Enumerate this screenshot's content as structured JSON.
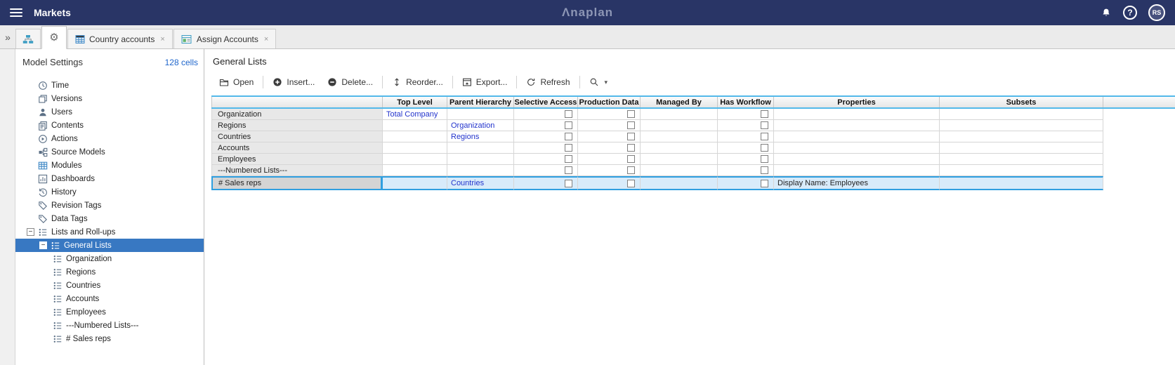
{
  "topbar": {
    "title": "Markets",
    "logo": "Λnaplan",
    "avatar": "RS"
  },
  "icons": {
    "collapse_panel": "»",
    "caret": "▾",
    "close": "×",
    "help": "?",
    "minus": "−",
    "gear": "⚙"
  },
  "tabbar": {
    "tabs": [
      {
        "label": "Country accounts"
      },
      {
        "label": "Assign Accounts"
      }
    ]
  },
  "sidebar": {
    "title": "Model Settings",
    "cells_link": "128 cells",
    "items": [
      {
        "label": "Time"
      },
      {
        "label": "Versions"
      },
      {
        "label": "Users"
      },
      {
        "label": "Contents"
      },
      {
        "label": "Actions"
      },
      {
        "label": "Source Models"
      },
      {
        "label": "Modules"
      },
      {
        "label": "Dashboards"
      },
      {
        "label": "History"
      },
      {
        "label": "Revision Tags"
      },
      {
        "label": "Data Tags"
      },
      {
        "label": "Lists and Roll-ups"
      },
      {
        "label": "General Lists"
      },
      {
        "label": "Organization"
      },
      {
        "label": "Regions"
      },
      {
        "label": "Countries"
      },
      {
        "label": "Accounts"
      },
      {
        "label": "Employees"
      },
      {
        "label": "---Numbered Lists---"
      },
      {
        "label": "# Sales reps"
      }
    ]
  },
  "main": {
    "title": "General Lists",
    "toolbar": {
      "open": "Open",
      "insert": "Insert...",
      "delete": "Delete...",
      "reorder": "Reorder...",
      "export": "Export...",
      "refresh": "Refresh"
    },
    "table": {
      "columns": [
        "Top Level",
        "Parent Hierarchy",
        "Selective Access",
        "Production Data",
        "Managed By",
        "Has Workflow",
        "Properties",
        "Subsets"
      ],
      "rows": [
        {
          "name": "Organization",
          "top_level": "Total Company",
          "parent_hierarchy": "",
          "managed_by": "",
          "properties": "",
          "subsets": ""
        },
        {
          "name": "Regions",
          "top_level": "",
          "parent_hierarchy": "Organization",
          "managed_by": "",
          "properties": "",
          "subsets": ""
        },
        {
          "name": "Countries",
          "top_level": "",
          "parent_hierarchy": "Regions",
          "managed_by": "",
          "properties": "",
          "subsets": ""
        },
        {
          "name": "Accounts",
          "top_level": "",
          "parent_hierarchy": "",
          "managed_by": "",
          "properties": "",
          "subsets": ""
        },
        {
          "name": "Employees",
          "top_level": "",
          "parent_hierarchy": "",
          "managed_by": "",
          "properties": "",
          "subsets": ""
        },
        {
          "name": "---Numbered Lists---",
          "top_level": "",
          "parent_hierarchy": "",
          "managed_by": "",
          "properties": "",
          "subsets": ""
        },
        {
          "name": "# Sales reps",
          "top_level": "",
          "parent_hierarchy": "Countries",
          "managed_by": "",
          "properties": "Display Name: Employees",
          "subsets": ""
        }
      ]
    }
  },
  "colors": {
    "topbar_navy": "#293566",
    "selection_blue": "#3878c2",
    "header_accent_cyan": "#53b9ea",
    "selected_row_blue": "#2f9fe0",
    "link_blue": "#2233cc"
  }
}
